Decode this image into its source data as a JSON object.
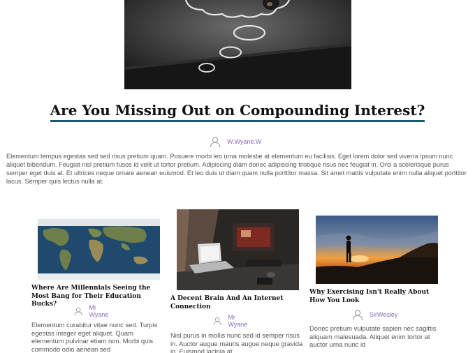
{
  "featured": {
    "image_alt": "chalkboard thought bubbles",
    "title": "Are You Missing Out on Compounding Interest?",
    "author": "W.Wyane.W",
    "excerpt": "Elementum tempus egestas sed sed risus pretium quam. Posuere morbi leo urna molestie at elementum eu facilisis. Eget lorem dolor sed viverra ipsum nunc aliquet bibendum. Feugiat nisl pretium fusce id velit ut tortor pretium. Adipiscing diam donec adipiscing tristique risus nec feugiat in. Orci a scelerisque purus semper eget duis at. Et ultrices neque ornare aenean euismod. Et leo duis ut diam quam nulla porttitor massa. Sit amet mattis vulputate enim nulla aliquet porttitor lacus. Semper quis lectus nulla at."
  },
  "cards": [
    {
      "title": "Where Are Millennials Seeing the Most Bang for Their Education Bucks?",
      "author": "Mr Wyane",
      "excerpt": "Elementum curabitur vitae nunc sed. Turpis egestas integer eget aliquet. Quam elementum pulvinar etiam non. Morbi quis commodo odio aenean sed"
    },
    {
      "title": "A Decent Brain And An Internet Connection",
      "author": "Mr Wyane",
      "excerpt": "Nisl purus in mollis nunc sed id semper risus in. Auctor augue mauris augue neque gravida in. Euismod lacinia at"
    },
    {
      "title": "Why Exercising Isn't Really About How You Look",
      "author": "SirWesley",
      "excerpt": "Donec pretium vulputate sapien nec sagittis aliquam malesuada. Aliquet enim tortor at auctor urna nunc id"
    }
  ],
  "colors": {
    "title_underline": "#1a5a6e",
    "author_link": "#8a6bb8"
  },
  "icons": {
    "author": "user-icon"
  }
}
